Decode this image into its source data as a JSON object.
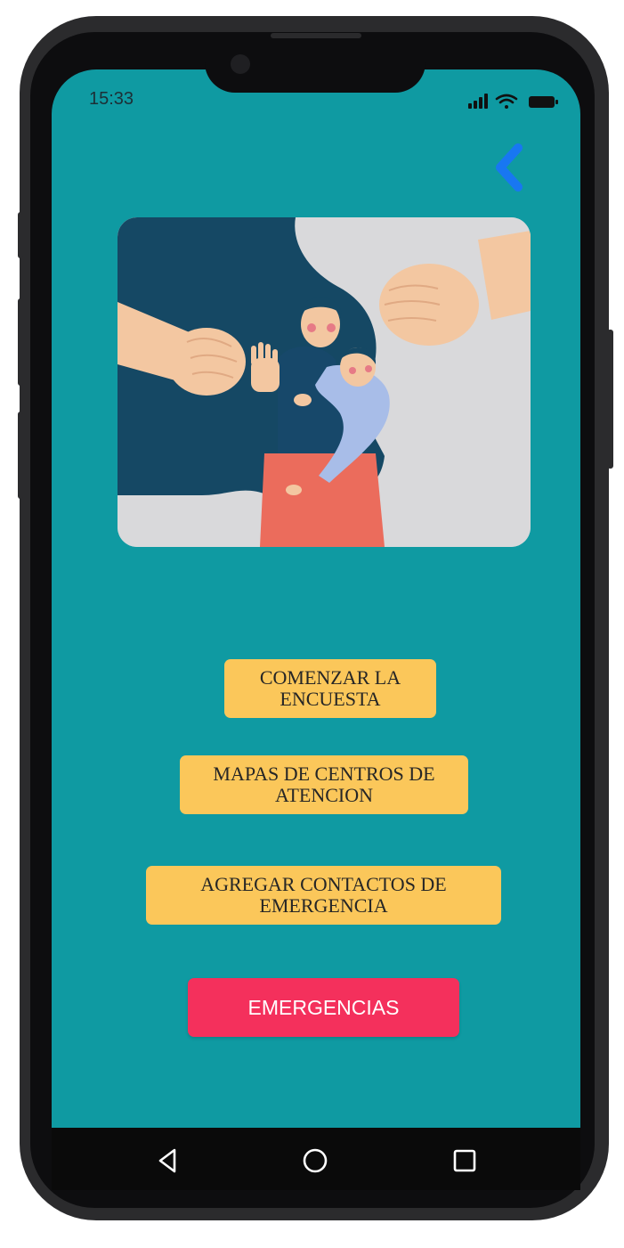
{
  "status_bar": {
    "time": "15:33",
    "icons": [
      "signal-icon",
      "wifi-icon",
      "battery-icon"
    ]
  },
  "header": {
    "back_icon": "chevron-left-icon",
    "back_color": "#1877f2"
  },
  "illustration": {
    "subject": "woman-holding-baby-threatened-by-fists"
  },
  "menu": {
    "survey_label": "COMENZAR LA\nENCUESTA",
    "maps_label": "MAPAS DE CENTROS DE\nATENCION",
    "contacts_label": "AGREGAR CONTACTOS DE\nEMERGENCIA",
    "emergency_label": "EMERGENCIAS"
  },
  "navigation": {
    "items": [
      "back-triangle-icon",
      "home-circle-icon",
      "recents-square-icon"
    ]
  },
  "colors": {
    "background": "#0f9aa2",
    "menu_button": "#fbc75a",
    "emergency_button": "#f4305c"
  }
}
